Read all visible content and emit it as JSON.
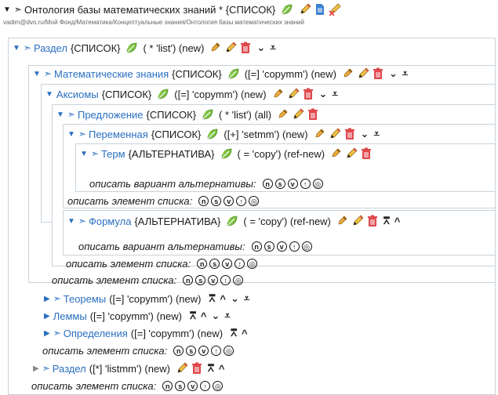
{
  "header": {
    "title": "Онтология базы математических знаний * {СПИСОК}",
    "path": "vadim@dvo.ru/Мой Фонд/Математика/Концептуальные знания/Онтология базы математических знаний"
  },
  "nodes": {
    "razdel1": {
      "name": "Раздел",
      "rest": "{СПИСОК}",
      "spec": "( * 'list') (new)"
    },
    "mathknow": {
      "name": "Математические знания",
      "rest": "{СПИСОК}",
      "spec": "([=] 'copymm') (new)"
    },
    "axioms": {
      "name": "Аксиомы",
      "rest": "{СПИСОК}",
      "spec": "([=] 'copymm') (new)"
    },
    "sentence": {
      "name": "Предложение",
      "rest": "{СПИСОК}",
      "spec": "( * 'list') (all)"
    },
    "variable": {
      "name": "Переменная",
      "rest": "{СПИСОК}",
      "spec": "([+] 'setmm') (new)"
    },
    "term": {
      "name": "Терм",
      "rest": "{АЛЬТЕРНАТИВА}",
      "spec": "( = 'copy') (ref-new)"
    },
    "formula": {
      "name": "Формула",
      "rest": "{АЛЬТЕРНАТИВА}",
      "spec": "( = 'copy') (ref-new)"
    },
    "theorems": {
      "name": "Теоремы",
      "spec": "([=] 'copymm') (new)"
    },
    "lemmas": {
      "name": "Леммы",
      "spec": "([=] 'copymm') (new)"
    },
    "definitions": {
      "name": "Определения",
      "spec": "([=] 'copymm') (new)"
    },
    "razdel2": {
      "name": "Раздел",
      "spec": "([*] 'listmm') (new)"
    }
  },
  "labels": {
    "describe_alt": "описать вариант альтернативы:",
    "describe_item": "описать элемент списка:"
  },
  "circle_letters": [
    "n",
    "s",
    "v",
    "↑",
    "◎"
  ],
  "colors": {
    "link": "#2a6fc0",
    "border": "#c8d2da",
    "trash": "#e0474c",
    "leaf": "#7cc243",
    "pencil": "#e7b43a"
  }
}
